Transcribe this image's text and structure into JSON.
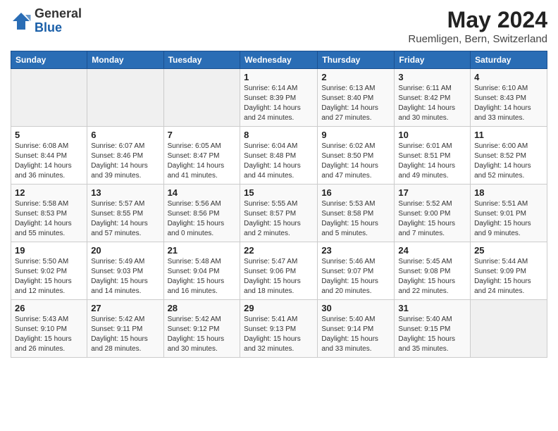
{
  "logo": {
    "general": "General",
    "blue": "Blue"
  },
  "title": {
    "month_year": "May 2024",
    "location": "Ruemligen, Bern, Switzerland"
  },
  "weekdays": [
    "Sunday",
    "Monday",
    "Tuesday",
    "Wednesday",
    "Thursday",
    "Friday",
    "Saturday"
  ],
  "weeks": [
    [
      {
        "day": "",
        "info": ""
      },
      {
        "day": "",
        "info": ""
      },
      {
        "day": "",
        "info": ""
      },
      {
        "day": "1",
        "info": "Sunrise: 6:14 AM\nSunset: 8:39 PM\nDaylight: 14 hours and 24 minutes."
      },
      {
        "day": "2",
        "info": "Sunrise: 6:13 AM\nSunset: 8:40 PM\nDaylight: 14 hours and 27 minutes."
      },
      {
        "day": "3",
        "info": "Sunrise: 6:11 AM\nSunset: 8:42 PM\nDaylight: 14 hours and 30 minutes."
      },
      {
        "day": "4",
        "info": "Sunrise: 6:10 AM\nSunset: 8:43 PM\nDaylight: 14 hours and 33 minutes."
      }
    ],
    [
      {
        "day": "5",
        "info": "Sunrise: 6:08 AM\nSunset: 8:44 PM\nDaylight: 14 hours and 36 minutes."
      },
      {
        "day": "6",
        "info": "Sunrise: 6:07 AM\nSunset: 8:46 PM\nDaylight: 14 hours and 39 minutes."
      },
      {
        "day": "7",
        "info": "Sunrise: 6:05 AM\nSunset: 8:47 PM\nDaylight: 14 hours and 41 minutes."
      },
      {
        "day": "8",
        "info": "Sunrise: 6:04 AM\nSunset: 8:48 PM\nDaylight: 14 hours and 44 minutes."
      },
      {
        "day": "9",
        "info": "Sunrise: 6:02 AM\nSunset: 8:50 PM\nDaylight: 14 hours and 47 minutes."
      },
      {
        "day": "10",
        "info": "Sunrise: 6:01 AM\nSunset: 8:51 PM\nDaylight: 14 hours and 49 minutes."
      },
      {
        "day": "11",
        "info": "Sunrise: 6:00 AM\nSunset: 8:52 PM\nDaylight: 14 hours and 52 minutes."
      }
    ],
    [
      {
        "day": "12",
        "info": "Sunrise: 5:58 AM\nSunset: 8:53 PM\nDaylight: 14 hours and 55 minutes."
      },
      {
        "day": "13",
        "info": "Sunrise: 5:57 AM\nSunset: 8:55 PM\nDaylight: 14 hours and 57 minutes."
      },
      {
        "day": "14",
        "info": "Sunrise: 5:56 AM\nSunset: 8:56 PM\nDaylight: 15 hours and 0 minutes."
      },
      {
        "day": "15",
        "info": "Sunrise: 5:55 AM\nSunset: 8:57 PM\nDaylight: 15 hours and 2 minutes."
      },
      {
        "day": "16",
        "info": "Sunrise: 5:53 AM\nSunset: 8:58 PM\nDaylight: 15 hours and 5 minutes."
      },
      {
        "day": "17",
        "info": "Sunrise: 5:52 AM\nSunset: 9:00 PM\nDaylight: 15 hours and 7 minutes."
      },
      {
        "day": "18",
        "info": "Sunrise: 5:51 AM\nSunset: 9:01 PM\nDaylight: 15 hours and 9 minutes."
      }
    ],
    [
      {
        "day": "19",
        "info": "Sunrise: 5:50 AM\nSunset: 9:02 PM\nDaylight: 15 hours and 12 minutes."
      },
      {
        "day": "20",
        "info": "Sunrise: 5:49 AM\nSunset: 9:03 PM\nDaylight: 15 hours and 14 minutes."
      },
      {
        "day": "21",
        "info": "Sunrise: 5:48 AM\nSunset: 9:04 PM\nDaylight: 15 hours and 16 minutes."
      },
      {
        "day": "22",
        "info": "Sunrise: 5:47 AM\nSunset: 9:06 PM\nDaylight: 15 hours and 18 minutes."
      },
      {
        "day": "23",
        "info": "Sunrise: 5:46 AM\nSunset: 9:07 PM\nDaylight: 15 hours and 20 minutes."
      },
      {
        "day": "24",
        "info": "Sunrise: 5:45 AM\nSunset: 9:08 PM\nDaylight: 15 hours and 22 minutes."
      },
      {
        "day": "25",
        "info": "Sunrise: 5:44 AM\nSunset: 9:09 PM\nDaylight: 15 hours and 24 minutes."
      }
    ],
    [
      {
        "day": "26",
        "info": "Sunrise: 5:43 AM\nSunset: 9:10 PM\nDaylight: 15 hours and 26 minutes."
      },
      {
        "day": "27",
        "info": "Sunrise: 5:42 AM\nSunset: 9:11 PM\nDaylight: 15 hours and 28 minutes."
      },
      {
        "day": "28",
        "info": "Sunrise: 5:42 AM\nSunset: 9:12 PM\nDaylight: 15 hours and 30 minutes."
      },
      {
        "day": "29",
        "info": "Sunrise: 5:41 AM\nSunset: 9:13 PM\nDaylight: 15 hours and 32 minutes."
      },
      {
        "day": "30",
        "info": "Sunrise: 5:40 AM\nSunset: 9:14 PM\nDaylight: 15 hours and 33 minutes."
      },
      {
        "day": "31",
        "info": "Sunrise: 5:40 AM\nSunset: 9:15 PM\nDaylight: 15 hours and 35 minutes."
      },
      {
        "day": "",
        "info": ""
      }
    ]
  ]
}
